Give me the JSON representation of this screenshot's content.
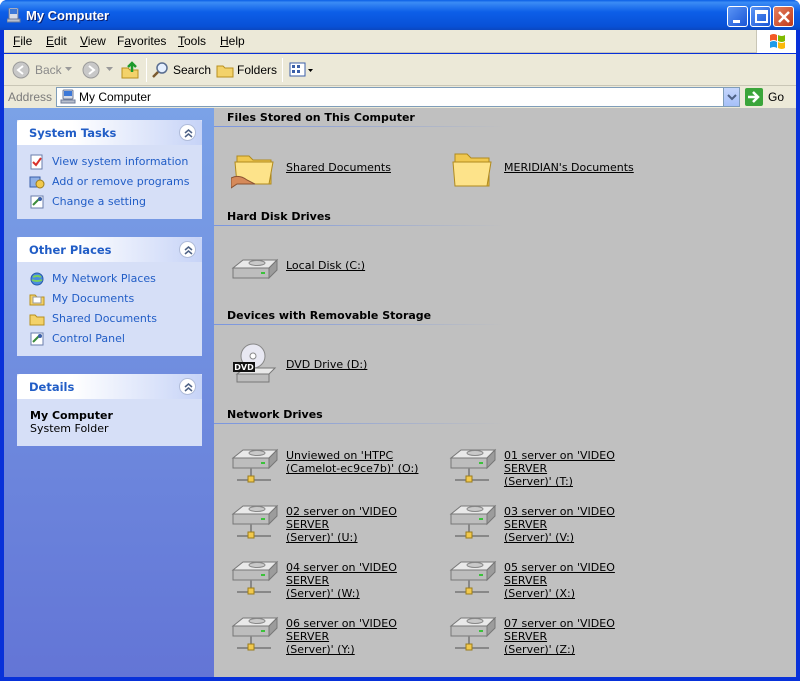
{
  "window": {
    "title": "My Computer"
  },
  "menu": [
    "File",
    "Edit",
    "View",
    "Favorites",
    "Tools",
    "Help"
  ],
  "menu_mnemonic": [
    "F",
    "E",
    "V",
    "a",
    "T",
    "H"
  ],
  "toolbar": {
    "back": "Back",
    "search": "Search",
    "folders": "Folders"
  },
  "address": {
    "label": "Address",
    "value": "My Computer",
    "go": "Go"
  },
  "system_tasks": {
    "title": "System Tasks",
    "items": [
      "View system information",
      "Add or remove programs",
      "Change a setting"
    ]
  },
  "other_places": {
    "title": "Other Places",
    "items": [
      "My Network Places",
      "My Documents",
      "Shared Documents",
      "Control Panel"
    ]
  },
  "details": {
    "title": "Details",
    "name": "My Computer",
    "type": "System Folder"
  },
  "groups": {
    "files": {
      "title": "Files Stored on This Computer",
      "items": [
        "Shared Documents",
        "MERIDIAN's Documents"
      ]
    },
    "hdd": {
      "title": "Hard Disk Drives",
      "items": [
        "Local Disk (C:)"
      ]
    },
    "removable": {
      "title": "Devices with Removable Storage",
      "items": [
        "DVD Drive (D:)"
      ]
    },
    "network": {
      "title": "Network Drives",
      "items": [
        "Unviewed on 'HTPC\n(Camelot-ec9ce7b)' (O:)",
        "01 server on 'VIDEO SERVER\n(Server)' (T:)",
        "02 server on 'VIDEO SERVER\n(Server)' (U:)",
        "03 server on 'VIDEO SERVER\n(Server)' (V:)",
        "04 server on 'VIDEO SERVER\n(Server)' (W:)",
        "05 server on 'VIDEO SERVER\n(Server)' (X:)",
        "06 server on 'VIDEO SERVER\n(Server)' (Y:)",
        "07 server on 'VIDEO SERVER\n(Server)' (Z:)"
      ]
    }
  },
  "colors": {
    "titlebar": "#0a5fe6",
    "link": "#215dc6",
    "taskpane": "#7ba2e7",
    "content_bg": "#c0c0c0"
  }
}
